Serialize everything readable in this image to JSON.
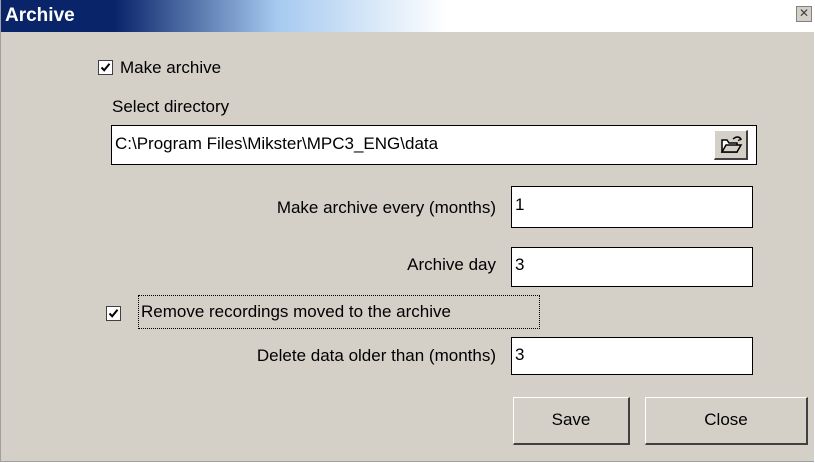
{
  "window": {
    "title": "Archive",
    "close_glyph": "✕"
  },
  "make_archive": {
    "checked": true,
    "label": "Make archive"
  },
  "directory": {
    "label": "Select directory",
    "value": "C:\\Program Files\\Mikster\\MPC3_ENG\\data",
    "browse_icon": "folder-open-icon"
  },
  "archive_every": {
    "label": "Make archive every (months)",
    "value": "1"
  },
  "archive_day": {
    "label": "Archive day",
    "value": "3"
  },
  "remove_recordings": {
    "checked": true,
    "label": "Remove recordings moved to the archive"
  },
  "delete_older": {
    "label": "Delete data older than (months)",
    "value": "3"
  },
  "buttons": {
    "save": "Save",
    "close": "Close"
  },
  "colors": {
    "dialog_bg": "#d4d0c8",
    "title_bar_start": "#0a246a",
    "title_text": "#ffffff"
  }
}
